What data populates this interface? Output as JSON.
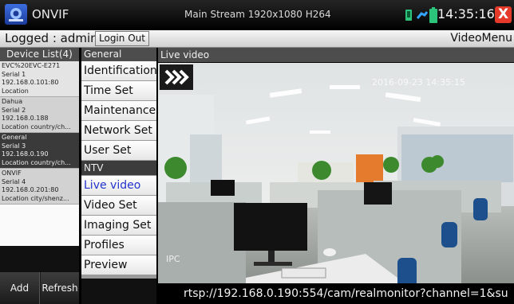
{
  "titlebar": {
    "app_name": "ONVIF",
    "stream_info": "Main Stream 1920x1080 H264",
    "clock": "14:35:16",
    "close_label": "X",
    "icons": [
      "onvif-logo-icon",
      "wifi-icon",
      "battery-icon",
      "close-icon"
    ]
  },
  "status": {
    "logged": "Logged : admin",
    "login_out": "Login Out",
    "video_menu": "VideoMenu"
  },
  "device_list": {
    "header": "Device List(4)",
    "devices": [
      {
        "l1": "EVC%20EVC-E271",
        "l2": "Serial 1",
        "l3": "192.168.0.101:80",
        "l4": "Location"
      },
      {
        "l1": "Dahua",
        "l2": "Serial 2",
        "l3": "192.168.0.188",
        "l4": "Location country/ch..."
      },
      {
        "l1": "General",
        "l2": "Serial 3",
        "l3": "192.168.0.190",
        "l4": "Location country/ch..."
      },
      {
        "l1": "ONVIF",
        "l2": "Serial 4",
        "l3": "192.168.0.201:80",
        "l4": "Location city/shenz..."
      }
    ],
    "add_label": "Add",
    "refresh_label": "Refresh"
  },
  "menu": {
    "header": "General",
    "general_items": [
      "Identification",
      "Time Set",
      "Maintenance",
      "Network Set",
      "User Set"
    ],
    "ntv_header": "NTV",
    "ntv_items": [
      "Live video",
      "Video Set",
      "Imaging Set",
      "Profiles",
      "Preview"
    ],
    "active_item": "Live video"
  },
  "video": {
    "header": "Live video",
    "osd_timestamp": "2016-09-23 14:35:15",
    "osd_label": "IPC",
    "rtsp_url": "rtsp://192.168.0.190:554/cam/realmonitor?channel=1&su"
  },
  "colors": {
    "titlebar": "#000000",
    "close_button": "#e53a2a",
    "active_menu_text": "#2233cc",
    "selected_device": "#3a3a3a"
  }
}
